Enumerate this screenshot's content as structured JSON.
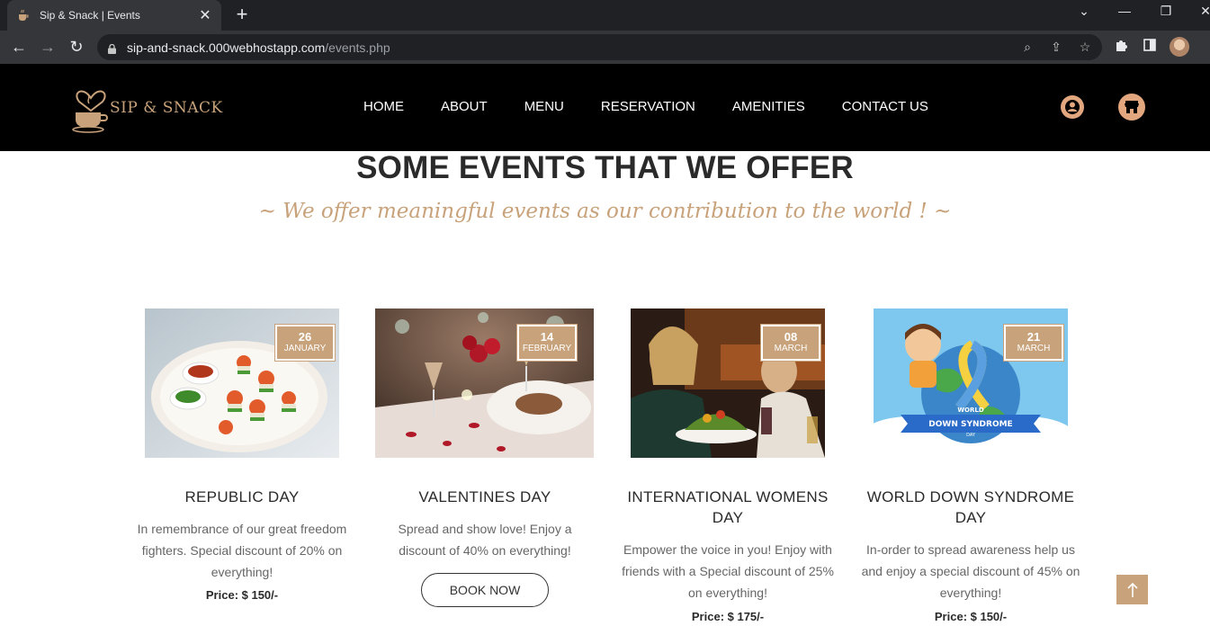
{
  "browser": {
    "tab_title": "Sip & Snack | Events",
    "url_host": "sip-and-snack.000webhostapp.com",
    "url_path": "/events.php"
  },
  "site": {
    "logo_text": "SIP & SNACK",
    "nav": [
      "HOME",
      "ABOUT",
      "MENU",
      "RESERVATION",
      "AMENITIES",
      "CONTACT US"
    ]
  },
  "section": {
    "title": "SOME EVENTS THAT WE OFFER",
    "subtitle": "~ We offer meaningful events as our contribution to the world ! ~"
  },
  "events": [
    {
      "day": "26",
      "month": "JANUARY",
      "title": "REPUBLIC DAY",
      "description": "In remembrance of our great freedom fighters. Special discount of 20% on everything!",
      "price": "Price: $ 150/-"
    },
    {
      "day": "14",
      "month": "FEBRUARY",
      "title": "VALENTINES DAY",
      "description": "Spread and show love! Enjoy a discount of 40% on everything!",
      "button": "BOOK NOW"
    },
    {
      "day": "08",
      "month": "MARCH",
      "title": "INTERNATIONAL WOMENS DAY",
      "description": "Empower the voice in you! Enjoy with friends with a Special discount of 25% on everything!",
      "price": "Price: $ 175/-"
    },
    {
      "day": "21",
      "month": "MARCH",
      "title": "WORLD DOWN SYNDROME DAY",
      "description": "In-order to spread awareness help us and enjoy a special discount of 45% on everything!",
      "price": "Price: $ 150/-",
      "image_text": [
        "WORLD",
        "DOWN SYNDROME",
        "DAY"
      ]
    }
  ],
  "colors": {
    "accent": "#c8a27a",
    "header_bg": "#000000",
    "icon_bg": "#e3a77f"
  },
  "icons": [
    "user-icon",
    "store-icon",
    "arrow-up-icon"
  ]
}
